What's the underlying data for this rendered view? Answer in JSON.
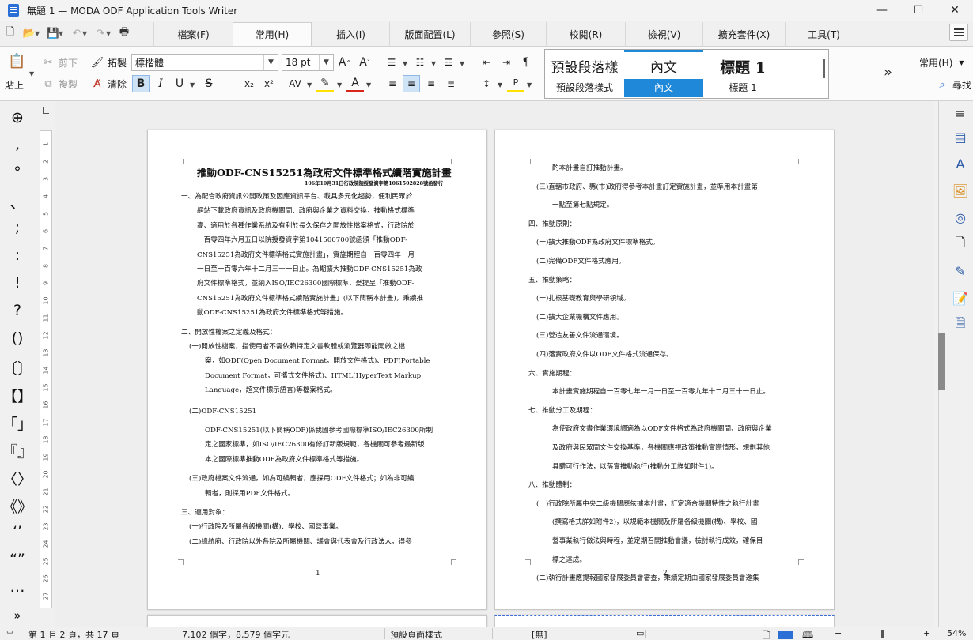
{
  "window": {
    "title": "無題 1 — MODA ODF Application Tools Writer",
    "minimize": "—",
    "maximize": "☐",
    "close": "✕"
  },
  "tabs": [
    "檔案(F)",
    "常用(H)",
    "插入(I)",
    "版面配置(L)",
    "參照(S)",
    "校閱(R)",
    "檢視(V)",
    "擴充套件(X)",
    "工具(T)"
  ],
  "ribbon": {
    "paste": "貼上",
    "cut": "剪下",
    "copy": "複製",
    "clone": "拓製",
    "clear": "清除",
    "font_name": "標楷體",
    "font_size": "18 pt",
    "styles": [
      {
        "preview": "預設段落樣",
        "label": "預設段落樣式"
      },
      {
        "preview": "內文",
        "label": "內文"
      },
      {
        "preview": "標題 1",
        "label": "標題 1"
      }
    ],
    "search_menu": "常用(H)",
    "find": "尋找"
  },
  "symbols": [
    "⊕",
    ",",
    "°",
    "、",
    ";",
    ":",
    "!",
    "?",
    "()",
    "〔〕",
    "【】",
    "「」",
    "『』",
    "〈〉",
    "《》",
    "‘’",
    "“”",
    "…",
    "»"
  ],
  "page1": {
    "title": "推動ODF-CNS15251為政府文件標準格式續階實施計畫",
    "subtitle": "106年10月31日行政院院授發資字第1061502828號函發行",
    "lines": [
      "一、為配合政府資訊公開政策及因應資訊平台、載具多元化趨勢，便利民眾於",
      "網站下載政府資訊及政府機關間、政府與企業之資料交換，推動格式標準",
      "高、適用於各種作業系統及有利於長久保存之開放性檔案格式，行政院於",
      "一百零四年六月五日以院授發資字第1041500700號函頒「推動ODF-",
      "CNS15251為政府文件標準格式實施計畫」，實施期程自一百零四年一月",
      "一日至一百零六年十二月三十一日止。為期擴大推動ODF-CNS15251為政",
      "府文件標準格式，並納入ISO/IEC26300國際標準，爰提呈「推動ODF-",
      "CNS15251為政府文件標準格式續階實施計畫」(以下簡稱本計畫)，秉續推",
      "動ODF-CNS15251為政府文件標準格式等措施。",
      "二、開放性檔案之定義及格式：",
      "(一)開放性檔案，指使用者不需依賴特定文書軟體或瀏覽器即能開啟之檔",
      "案，如ODF(Open Document Format，開放文件格式)、PDF(Portable",
      "Document Format，可攜式文件格式)、HTML(HyperText Markup",
      "Language，超文件標示語言)等檔案格式。",
      "(二)ODF-CNS15251",
      "ODF-CNS15251(以下簡稱ODF)係我國參考國際標準ISO/IEC26300所制",
      "定之國家標準，如ISO/IEC26300有修訂新版規範，各機關可參考最新版",
      "本之國際標準推動ODF為政府文件標準格式等措施。",
      "(三)政府檔案文件流通，如為可編輯者，應採用ODF文件格式；如為非可編",
      "輯者，則採用PDF文件格式。",
      "三、適用對象：",
      "(一)行政院及所屬各級機關(構)、學校、國營事業。",
      "(二)總統府、行政院以外各院及所屬機關、議會與代表會及行政法人，得參"
    ],
    "number": "1"
  },
  "page2": {
    "lines": [
      "酌本計畫自訂推動計畫。",
      "(三)直轄市政府、縣(市)政府得參考本計畫訂定實施計畫，並準用本計畫第",
      "一點至第七點規定。",
      "四、推動原則：",
      "(一)擴大推動ODF為政府文件標準格式。",
      "(二)完備ODF文件格式應用。",
      "五、推動策略：",
      "(一)扎根基礎教育與學研領域。",
      "(二)擴大企業機構文件應用。",
      "(三)營造友善文件流通環境。",
      "(四)落實政府文件以ODF文件格式流通保存。",
      "六、實施期程：",
      "本計畫實施期程自一百零七年一月一日至一百零九年十二月三十一日止。",
      "七、推動分工及期程：",
      "為使政府文書作業環境調適為以ODF文件格式為政府機關間、政府與企業",
      "及政府與民眾間文件交換基準，各機關應視政策推動實際情形，規劃其他",
      "具體可行作法，以落實推動執行(推動分工詳如附件1)。",
      "八、推動體制：",
      "(一)行政院所屬中央二級機關應依據本計畫，訂定適合機關特性之執行計畫",
      "(撰寫格式詳如附件2)，以規範本機關及所屬各級機關(構)、學校、國",
      "營事業執行做法與時程，並定期召開推動會議，檢討執行成效，確保目",
      "標之達成。",
      "(二)執行計畫應提報國家發展委員會審查，秉續定期由國家發展委員會邀集"
    ],
    "number": "2"
  },
  "ruler": {
    "h_numbers": [
      "1",
      "2",
      "4",
      "6",
      "8",
      "10",
      "12",
      "14",
      "16",
      "18"
    ],
    "v_numbers": [
      "1",
      "2",
      "3",
      "4",
      "5",
      "6",
      "7",
      "8",
      "9",
      "10",
      "11",
      "12",
      "13",
      "14",
      "15",
      "16",
      "17",
      "18",
      "19",
      "20",
      "21",
      "22",
      "23",
      "24",
      "25",
      "26",
      "27"
    ]
  },
  "status": {
    "page": "第 1 且 2 頁，共 17 頁",
    "words": "7,102 個字，8,579 個字元",
    "page_style": "預設頁面樣式",
    "language": "[無]",
    "zoom": "54%"
  }
}
